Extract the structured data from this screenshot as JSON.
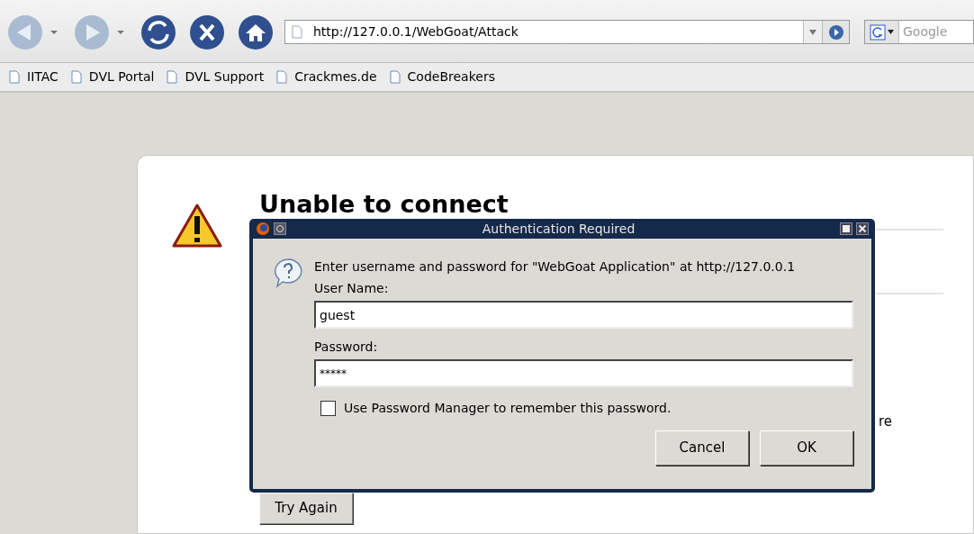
{
  "toolbar": {
    "address": "http://127.0.0.1/WebGoat/Attack",
    "search_placeholder": "Google"
  },
  "bookmarks": [
    "IITAC",
    "DVL Portal",
    "DVL Support",
    "Crackmes.de",
    "CodeBreakers"
  ],
  "error_page": {
    "title": "Unable to connect",
    "text_fragment": "re",
    "button": "Try Again"
  },
  "dialog": {
    "title": "Authentication Required",
    "message": "Enter username and password for \"WebGoat Application\" at http://127.0.0.1",
    "username_label": "User Name:",
    "username": "guest",
    "password_label": "Password:",
    "password": "*****",
    "remember": {
      "label": "Use Password Manager to remember this password.",
      "checked": false
    },
    "buttons": [
      "Cancel",
      "OK"
    ]
  }
}
